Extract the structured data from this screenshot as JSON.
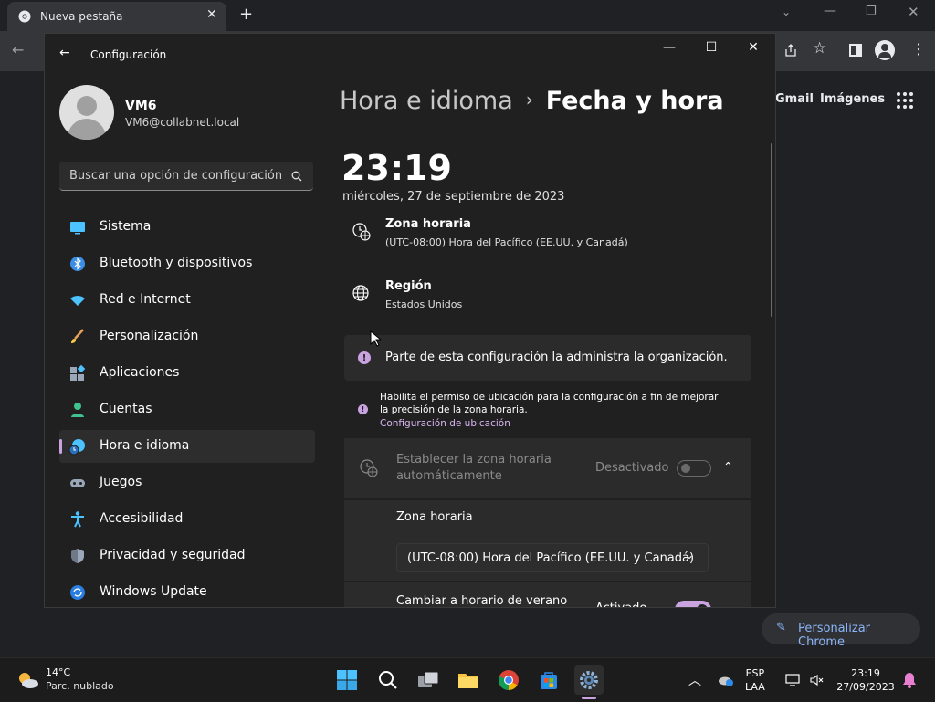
{
  "chrome": {
    "tab_title": "Nueva pestaña",
    "new_tab": "+",
    "links": [
      "Gmail",
      "Imágenes"
    ],
    "customize_label": "Personalizar Chrome"
  },
  "settings": {
    "window_title": "Configuración",
    "user": {
      "name": "VM6",
      "email": "VM6@collabnet.local"
    },
    "search_placeholder": "Buscar una opción de configuración",
    "nav": [
      {
        "label": "Sistema",
        "icon": "monitor-icon"
      },
      {
        "label": "Bluetooth y dispositivos",
        "icon": "bluetooth-icon"
      },
      {
        "label": "Red e Internet",
        "icon": "wifi-icon"
      },
      {
        "label": "Personalización",
        "icon": "brush-icon"
      },
      {
        "label": "Aplicaciones",
        "icon": "apps-icon"
      },
      {
        "label": "Cuentas",
        "icon": "person-icon"
      },
      {
        "label": "Hora e idioma",
        "icon": "globe-clock-icon",
        "active": true
      },
      {
        "label": "Juegos",
        "icon": "gamepad-icon"
      },
      {
        "label": "Accesibilidad",
        "icon": "accessibility-icon"
      },
      {
        "label": "Privacidad y seguridad",
        "icon": "shield-icon"
      },
      {
        "label": "Windows Update",
        "icon": "update-icon"
      }
    ],
    "breadcrumb": {
      "parent": "Hora e idioma",
      "separator": "›",
      "current": "Fecha y hora"
    },
    "time": "23:19",
    "date": "miércoles, 27 de septiembre de 2023",
    "timezone_row": {
      "title": "Zona horaria",
      "value": "(UTC-08:00) Hora del Pacífico (EE.UU. y Canadá)"
    },
    "region_row": {
      "title": "Región",
      "value": "Estados Unidos"
    },
    "managed_notice": "Parte de esta configuración la administra la organización.",
    "location_notice": {
      "text": "Habilita el permiso de ubicación para la configuración a fin de mejorar la precisión de la zona horaria.",
      "link": "Configuración de ubicación"
    },
    "auto_timezone": {
      "title": "Establecer la zona horaria automáticamente",
      "state": "Desactivado"
    },
    "timezone_select": {
      "label": "Zona horaria",
      "value": "(UTC-08:00) Hora del Pacífico (EE.UU. y Canadá)"
    },
    "dst": {
      "title": "Cambiar a horario de verano",
      "state": "Activado"
    }
  },
  "taskbar": {
    "weather": {
      "temp": "14°C",
      "desc": "Parc. nublado"
    },
    "lang": {
      "code": "ESP",
      "layout": "LAA"
    },
    "clock": {
      "time": "23:19",
      "date": "27/09/2023"
    }
  }
}
